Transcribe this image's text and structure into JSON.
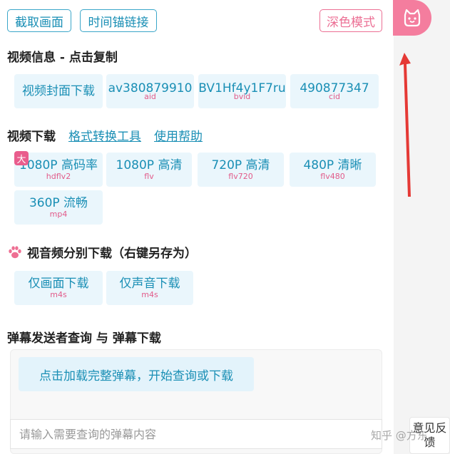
{
  "toolbar": {
    "screenshot_label": "截取画面",
    "timestamp_link_label": "时间锚链接",
    "dark_mode_label": "深色模式"
  },
  "video_info": {
    "title": "视频信息 - 点击复制",
    "items": [
      {
        "main": "视频封面下载",
        "sub": ""
      },
      {
        "main": "av380879910",
        "sub": "aid"
      },
      {
        "main": "BV1Hf4y1F7ru",
        "sub": "bvid"
      },
      {
        "main": "490877347",
        "sub": "cid"
      }
    ]
  },
  "video_download": {
    "title": "视频下载",
    "format_tool_link": "格式转换工具",
    "help_link": "使用帮助",
    "badge": "大",
    "items": [
      {
        "main": "1080P 高码率",
        "sub": "hdflv2"
      },
      {
        "main": "1080P 高清",
        "sub": "flv"
      },
      {
        "main": "720P 高清",
        "sub": "flv720"
      },
      {
        "main": "480P 清晰",
        "sub": "flv480"
      },
      {
        "main": "360P 流畅",
        "sub": "mp4"
      }
    ]
  },
  "av_split": {
    "title": "视音频分别下载（右键另存为）",
    "items": [
      {
        "main": "仅画面下载",
        "sub": "m4s"
      },
      {
        "main": "仅声音下载",
        "sub": "m4s"
      }
    ]
  },
  "danmu": {
    "title": "弹幕发送者查询 与 弹幕下载",
    "load_button": "点击加载完整弹幕，开始查询或下载",
    "search_placeholder": "请输入需要查询的弹幕内容"
  },
  "side": {
    "feedback_line1": "反",
    "feedback_line2": "反馈",
    "feedback_top": "意见反",
    "feedback_bottom": "馈"
  },
  "watermark": "知乎 @方东"
}
